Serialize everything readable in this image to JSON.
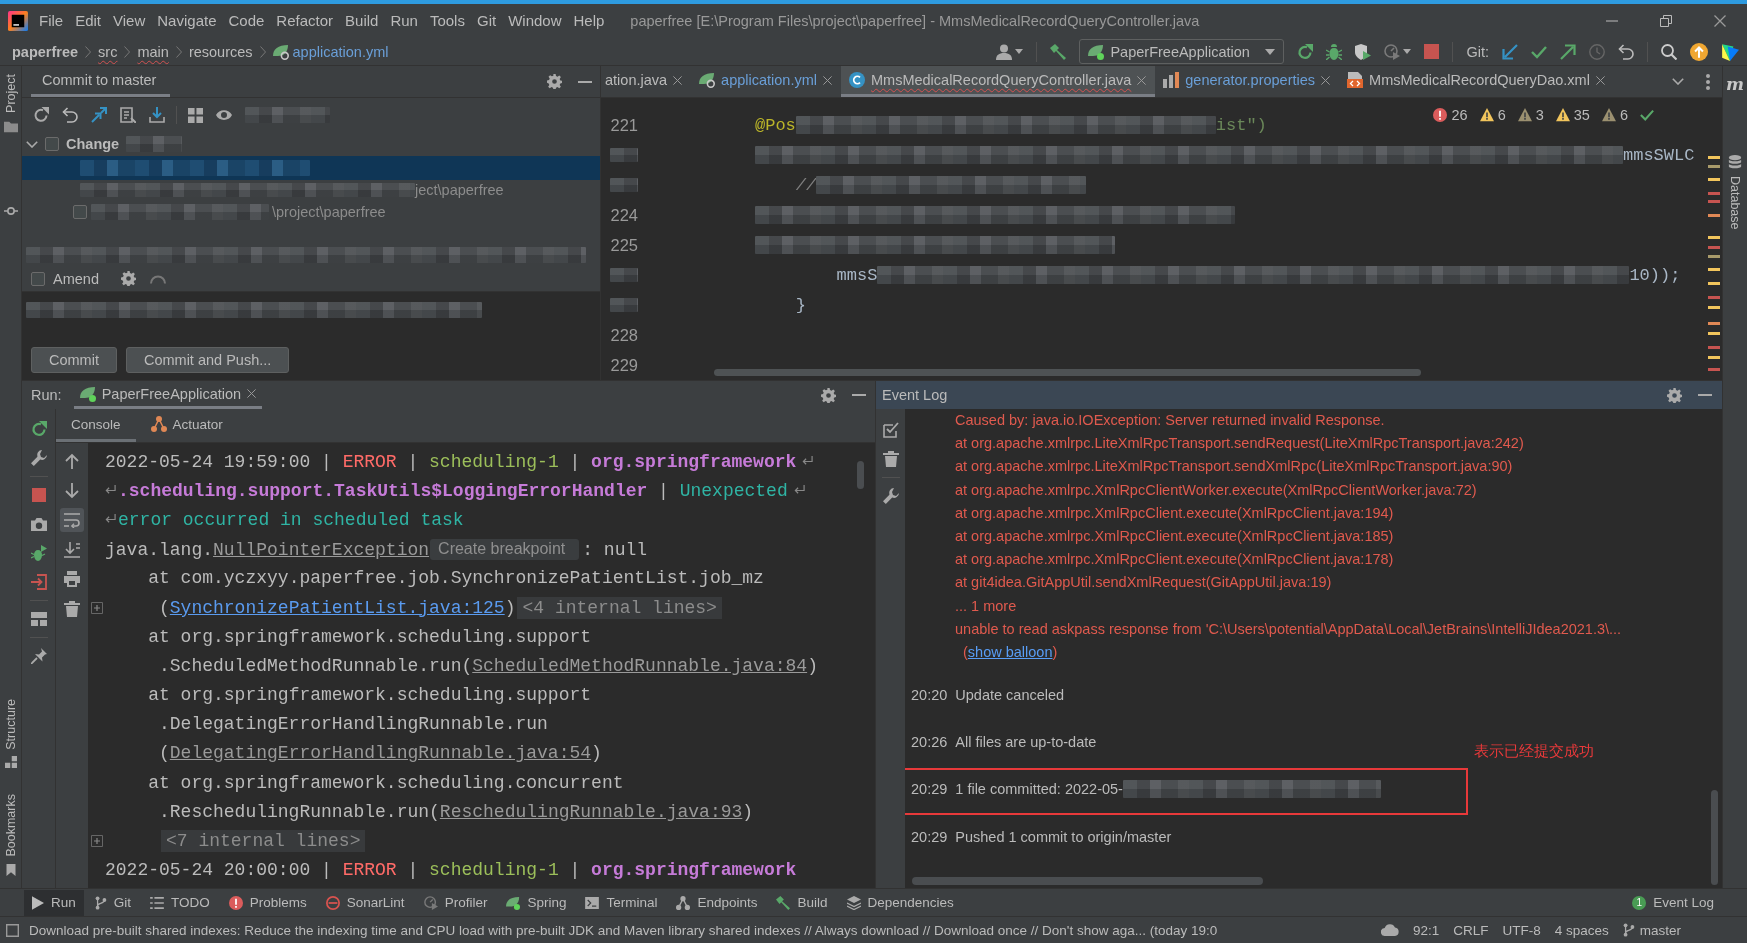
{
  "window": {
    "title": "paperfree [E:\\Program Files\\project\\paperfree] - MmsMedicalRecordQueryController.java"
  },
  "menu": [
    "File",
    "Edit",
    "View",
    "Navigate",
    "Code",
    "Refactor",
    "Build",
    "Run",
    "Tools",
    "Git",
    "Window",
    "Help"
  ],
  "breadcrumbs": [
    {
      "label": "paperfree",
      "kind": "project",
      "flagged": false
    },
    {
      "label": "src",
      "kind": "folder",
      "flagged": true
    },
    {
      "label": "main",
      "kind": "folder",
      "flagged": true
    },
    {
      "label": "resources",
      "kind": "folder",
      "flagged": false
    },
    {
      "label": "application.yml",
      "kind": "file",
      "flagged": false
    }
  ],
  "toolbar": {
    "run_configuration": "PaperFreeApplication",
    "vcs_label": "Git:"
  },
  "left_stripe": {
    "top": [
      {
        "label": "Project",
        "kind": "project"
      },
      {
        "kind": "commit"
      }
    ],
    "bottom": [
      {
        "label": "Structure",
        "kind": "structure"
      },
      {
        "label": "Bookmarks",
        "kind": "bookmarks"
      }
    ]
  },
  "right_stripe": [
    {
      "label": "m",
      "kind": "maven"
    },
    {
      "label": "Database",
      "kind": "database"
    }
  ],
  "commit_panel": {
    "title": "Commit to master",
    "changes": {
      "label": "Change",
      "checked": false,
      "expanded": true
    },
    "rows": [
      {
        "kind": "blurred",
        "selected": true
      },
      {
        "kind": "location",
        "selected": false,
        "path": "ject\\paperfree"
      },
      {
        "kind": "file",
        "selected": false,
        "checked": false,
        "path": "\\project\\paperfree"
      }
    ],
    "amend": {
      "label": "Amend",
      "checked": false
    },
    "buttons": [
      "Commit",
      "Commit and Push..."
    ]
  },
  "editor": {
    "tabs": [
      {
        "label": "ation.java",
        "kind": "java",
        "selected": false,
        "modified": false,
        "errors": false
      },
      {
        "label": "application.yml",
        "kind": "yaml",
        "selected": false,
        "modified": true,
        "errors": false
      },
      {
        "label": "MmsMedicalRecordQueryController.java",
        "kind": "class",
        "selected": true,
        "modified": false,
        "errors": true
      },
      {
        "label": "generator.properties",
        "kind": "properties",
        "selected": false,
        "modified": true,
        "errors": false
      },
      {
        "label": "MmsMedicalRecordQueryDao.xml",
        "kind": "xml",
        "selected": false,
        "modified": false,
        "errors": false
      }
    ],
    "inspections": [
      {
        "kind": "error",
        "count": "26"
      },
      {
        "kind": "warning",
        "count": "6"
      },
      {
        "kind": "weak_warning",
        "count": "3"
      },
      {
        "kind": "warning",
        "count": "35"
      },
      {
        "kind": "weak_warning",
        "count": "6"
      },
      {
        "kind": "ok"
      }
    ],
    "lines": [
      {
        "number": "221",
        "segments": [
          {
            "kind": "annotation",
            "text": "@Pos"
          },
          {
            "kind": "blurred"
          },
          {
            "kind": "string",
            "text": "ist\")"
          }
        ]
      },
      {
        "segments": [
          {
            "kind": "blurred"
          },
          {
            "kind": "plain",
            "text": "mmsSWLC"
          }
        ]
      },
      {
        "segments": [
          {
            "kind": "comment",
            "text": "    //"
          },
          {
            "kind": "blurred"
          }
        ]
      },
      {
        "number": "224",
        "segments": [
          {
            "kind": "blurred"
          }
        ]
      },
      {
        "number": "225",
        "segments": [
          {
            "kind": "blurred"
          }
        ]
      },
      {
        "segments": [
          {
            "kind": "plain",
            "text": "        mmsS"
          },
          {
            "kind": "blurred"
          },
          {
            "kind": "plain",
            "text": "10));"
          }
        ]
      },
      {
        "segments": [
          {
            "kind": "plain",
            "text": "    }"
          }
        ]
      },
      {
        "number": "228"
      },
      {
        "number": "229"
      }
    ]
  },
  "run_panel": {
    "label": "Run:",
    "tab": "PaperFreeApplication",
    "subtabs": [
      {
        "label": "Console",
        "kind": "console",
        "selected": true
      },
      {
        "label": "Actuator",
        "kind": "actuator",
        "selected": false
      }
    ],
    "soft_wrap_on": true,
    "console": [
      {
        "kind": "record",
        "wrap_mark": true,
        "folded": false,
        "segments": [
          {
            "kind": "plain",
            "text": "2022-05-24 19:59:00 | "
          },
          {
            "kind": "level",
            "text": "ERROR"
          },
          {
            "kind": "plain",
            "text": " | "
          },
          {
            "kind": "thread",
            "text": "scheduling-1"
          },
          {
            "kind": "plain",
            "text": " | "
          },
          {
            "kind": "logger",
            "text": "org.springframework"
          }
        ]
      },
      {
        "kind": "wrapped",
        "wrap_mark": true,
        "folded": false,
        "segments": [
          {
            "kind": "logger",
            "text": ".scheduling.support.TaskUtils$LoggingErrorHandler"
          },
          {
            "kind": "plain",
            "text": " | "
          },
          {
            "kind": "message",
            "text": "Unexpected"
          }
        ]
      },
      {
        "kind": "wrapped",
        "wrap_mark": false,
        "folded": false,
        "segments": [
          {
            "kind": "message",
            "text": "error occurred in scheduled task"
          }
        ]
      },
      {
        "kind": "record",
        "wrap_mark": false,
        "folded": false,
        "segments": [
          {
            "kind": "plain",
            "text": "java.lang."
          },
          {
            "kind": "link",
            "text": "NullPointerException"
          },
          {
            "kind": "hint",
            "text": "Create breakpoint"
          },
          {
            "kind": "plain",
            "text": ": null"
          }
        ]
      },
      {
        "kind": "frame",
        "wrap_mark": false,
        "folded": false,
        "segments": [
          {
            "kind": "plain",
            "text": "at com.yczxyy.paperfree.job.SynchronizePatientList.job_mz"
          }
        ]
      },
      {
        "kind": "continuation",
        "wrap_mark": false,
        "folded": true,
        "segments": [
          {
            "kind": "plain",
            "text": "("
          },
          {
            "kind": "source_link",
            "text": "SynchronizePatientList.java:125"
          },
          {
            "kind": "plain",
            "text": ")"
          },
          {
            "kind": "collapsed",
            "text": "<4 internal lines>"
          }
        ]
      },
      {
        "kind": "frame",
        "wrap_mark": false,
        "folded": false,
        "segments": [
          {
            "kind": "plain",
            "text": "at org.springframework.scheduling.support"
          }
        ]
      },
      {
        "kind": "continuation",
        "wrap_mark": false,
        "folded": false,
        "segments": [
          {
            "kind": "plain",
            "text": ".ScheduledMethodRunnable.run("
          },
          {
            "kind": "link",
            "text": "ScheduledMethodRunnable.java:84"
          },
          {
            "kind": "plain",
            "text": ")"
          }
        ]
      },
      {
        "kind": "frame",
        "wrap_mark": false,
        "folded": false,
        "segments": [
          {
            "kind": "plain",
            "text": "at org.springframework.scheduling.support"
          }
        ]
      },
      {
        "kind": "continuation",
        "wrap_mark": false,
        "folded": false,
        "segments": [
          {
            "kind": "plain",
            "text": ".DelegatingErrorHandlingRunnable.run"
          }
        ]
      },
      {
        "kind": "continuation",
        "wrap_mark": false,
        "folded": false,
        "segments": [
          {
            "kind": "plain",
            "text": "("
          },
          {
            "kind": "link",
            "text": "DelegatingErrorHandlingRunnable.java:54"
          },
          {
            "kind": "plain",
            "text": ")"
          }
        ]
      },
      {
        "kind": "frame",
        "wrap_mark": false,
        "folded": false,
        "segments": [
          {
            "kind": "plain",
            "text": "at org.springframework.scheduling.concurrent"
          }
        ]
      },
      {
        "kind": "continuation",
        "wrap_mark": false,
        "folded": false,
        "segments": [
          {
            "kind": "plain",
            "text": ".ReschedulingRunnable.run("
          },
          {
            "kind": "link",
            "text": "ReschedulingRunnable.java:93"
          },
          {
            "kind": "plain",
            "text": ")"
          }
        ]
      },
      {
        "kind": "continuation",
        "wrap_mark": false,
        "folded": true,
        "segments": [
          {
            "kind": "collapsed",
            "text": "<7 internal lines>"
          }
        ]
      },
      {
        "kind": "record",
        "wrap_mark": false,
        "folded": false,
        "segments": [
          {
            "kind": "plain",
            "text": "2022-05-24 20:00:00 | "
          },
          {
            "kind": "level",
            "text": "ERROR"
          },
          {
            "kind": "plain",
            "text": " | "
          },
          {
            "kind": "thread",
            "text": "scheduling-1"
          },
          {
            "kind": "plain",
            "text": " | "
          },
          {
            "kind": "logger",
            "text": "org.springframework"
          }
        ]
      }
    ]
  },
  "event_log": {
    "title": "Event Log",
    "trace": [
      "Caused by: java.io.IOException: Server returned invalid Response.",
      "at org.apache.xmlrpc.LiteXmlRpcTransport.sendRequest(LiteXmlRpcTransport.java:242)",
      "at org.apache.xmlrpc.LiteXmlRpcTransport.sendXmlRpc(LiteXmlRpcTransport.java:90)",
      "at org.apache.xmlrpc.XmlRpcClientWorker.execute(XmlRpcClientWorker.java:72)",
      "at org.apache.xmlrpc.XmlRpcClient.execute(XmlRpcClient.java:194)",
      "at org.apache.xmlrpc.XmlRpcClient.execute(XmlRpcClient.java:185)",
      "at org.apache.xmlrpc.XmlRpcClient.execute(XmlRpcClient.java:178)",
      "at git4idea.GitAppUtil.sendXmlRequest(GitAppUtil.java:19)",
      "... 1 more"
    ],
    "error_message": {
      "text": "unable to read askpass response from 'C:\\Users\\potential\\AppData\\Local\\JetBrains\\IntelliJIdea2021.3\\... (",
      "link": "show balloon",
      "after": ")"
    },
    "entries": [
      {
        "time": "20:20",
        "message": "Update canceled",
        "highlighted": false,
        "redacted": false
      },
      {
        "time": "20:26",
        "message": "All files are up-to-date",
        "highlighted": false,
        "redacted": false
      },
      {
        "time": "20:29",
        "message": "1 file committed: 2022-05-",
        "highlighted": true,
        "redacted": true,
        "note": "表示已经提交成功"
      },
      {
        "time": "20:29",
        "message": "Pushed 1 commit to origin/master",
        "highlighted": false,
        "redacted": false
      }
    ]
  },
  "bottom_tools": [
    {
      "label": "Run",
      "kind": "run",
      "selected": true
    },
    {
      "label": "Git",
      "kind": "git",
      "selected": false
    },
    {
      "label": "TODO",
      "kind": "todo",
      "selected": false
    },
    {
      "label": "Problems",
      "kind": "problems",
      "selected": false
    },
    {
      "label": "SonarLint",
      "kind": "sonarlint",
      "selected": false
    },
    {
      "label": "Profiler",
      "kind": "profiler",
      "selected": false
    },
    {
      "label": "Spring",
      "kind": "spring",
      "selected": false
    },
    {
      "label": "Terminal",
      "kind": "terminal",
      "selected": false
    },
    {
      "label": "Endpoints",
      "kind": "endpoints",
      "selected": false
    },
    {
      "label": "Build",
      "kind": "build",
      "selected": false
    },
    {
      "label": "Dependencies",
      "kind": "dependencies",
      "selected": false
    }
  ],
  "bottom_tools_right": [
    {
      "label": "Event Log",
      "badge": "1",
      "selected": false
    }
  ],
  "status_bar": {
    "message": "Download pre-built shared indexes: Reduce the indexing time and CPU load with pre-built JDK and Maven library shared indexes // Always download // Download once // Don't show aga... (today 19:0",
    "widgets": [
      {
        "kind": "sync"
      },
      {
        "kind": "text",
        "text": "92:1"
      },
      {
        "kind": "text",
        "text": "CRLF"
      },
      {
        "kind": "text",
        "text": "UTF-8"
      },
      {
        "kind": "text",
        "text": "4 spaces"
      },
      {
        "kind": "branch",
        "text": "master"
      }
    ]
  }
}
